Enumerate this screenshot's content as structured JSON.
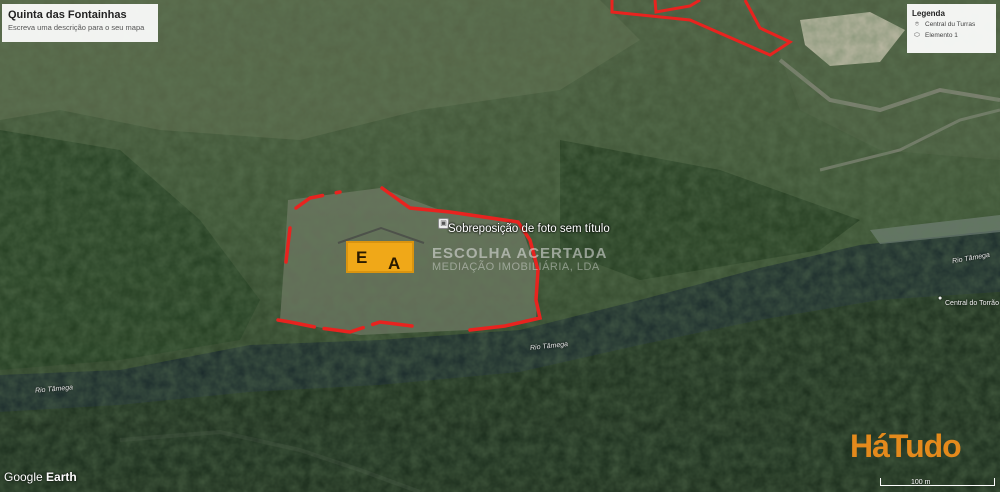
{
  "title": {
    "name": "Quinta das Fontainhas",
    "description": "Escreva uma descrição para o seu mapa"
  },
  "legend": {
    "title": "Legenda",
    "items": [
      {
        "label": "Central du Turras",
        "icon": "pin-icon"
      },
      {
        "label": "Elemento 1",
        "icon": "polygon-icon"
      }
    ]
  },
  "overlay_label": "Sobreposição de foto sem título",
  "watermark": {
    "letters": [
      "E",
      "A"
    ],
    "brand_line1": "ESCOLHA ACERTADA",
    "brand_line2": "MEDIAÇÃO IMOBILIÁRIA, LDA"
  },
  "river_labels": [
    "Rio Tâmega",
    "Rio Tâmega",
    "Rio Tâmega"
  ],
  "place_label": "Central do Torrão",
  "google_earth": {
    "word1": "Google",
    "word2": "Earth"
  },
  "hatudo_logo": "HáTudo",
  "scale_label": "100 m",
  "colors": {
    "boundary": "#e8231f",
    "river": "#1b2a2a",
    "forest": "#2d4526",
    "logo_orange": "#f0a818"
  }
}
